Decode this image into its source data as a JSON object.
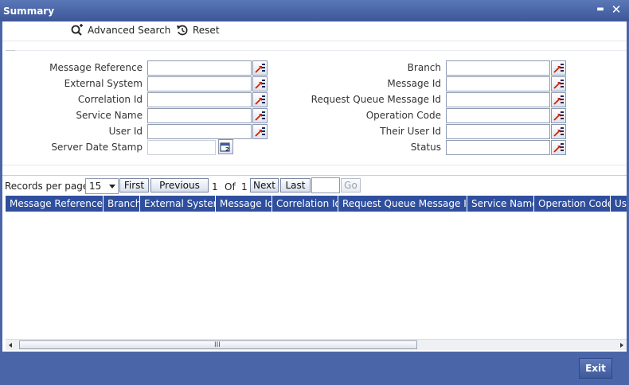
{
  "window": {
    "title": "Summary",
    "minimize_label": "▬",
    "close_label": "✕"
  },
  "toolbar": {
    "advanced_search": "Advanced Search",
    "reset": "Reset"
  },
  "form": {
    "left": [
      {
        "label": "Message Reference",
        "value": ""
      },
      {
        "label": "External System",
        "value": ""
      },
      {
        "label": "Correlation Id",
        "value": ""
      },
      {
        "label": "Service Name",
        "value": ""
      },
      {
        "label": "User Id",
        "value": ""
      },
      {
        "label": "Server Date Stamp",
        "value": ""
      }
    ],
    "right": [
      {
        "label": "Branch",
        "value": ""
      },
      {
        "label": "Message Id",
        "value": ""
      },
      {
        "label": "Request Queue Message Id",
        "value": ""
      },
      {
        "label": "Operation Code",
        "value": ""
      },
      {
        "label": "Their User Id",
        "value": ""
      },
      {
        "label": "Status",
        "value": ""
      }
    ]
  },
  "pager": {
    "records_per_page_label": "Records per page",
    "records_per_page": "15",
    "first": "First",
    "previous": "Previous",
    "current_page": "1",
    "of_label": "Of",
    "total_pages": "1",
    "next": "Next",
    "last": "Last",
    "goto_value": "",
    "go": "Go"
  },
  "grid": {
    "columns": [
      "Message Reference",
      "Branch",
      "External System",
      "Message Id",
      "Correlation Id",
      "Request Queue Message Id",
      "Service Name",
      "Operation Code",
      "User Id"
    ],
    "rows": []
  },
  "scrollbar": {
    "grip": "III"
  },
  "footer": {
    "exit": "Exit"
  },
  "colors": {
    "titlebar": "#4a66a8",
    "grid_header": "#2f4f9e",
    "lov_arrow": "#cc2200"
  }
}
